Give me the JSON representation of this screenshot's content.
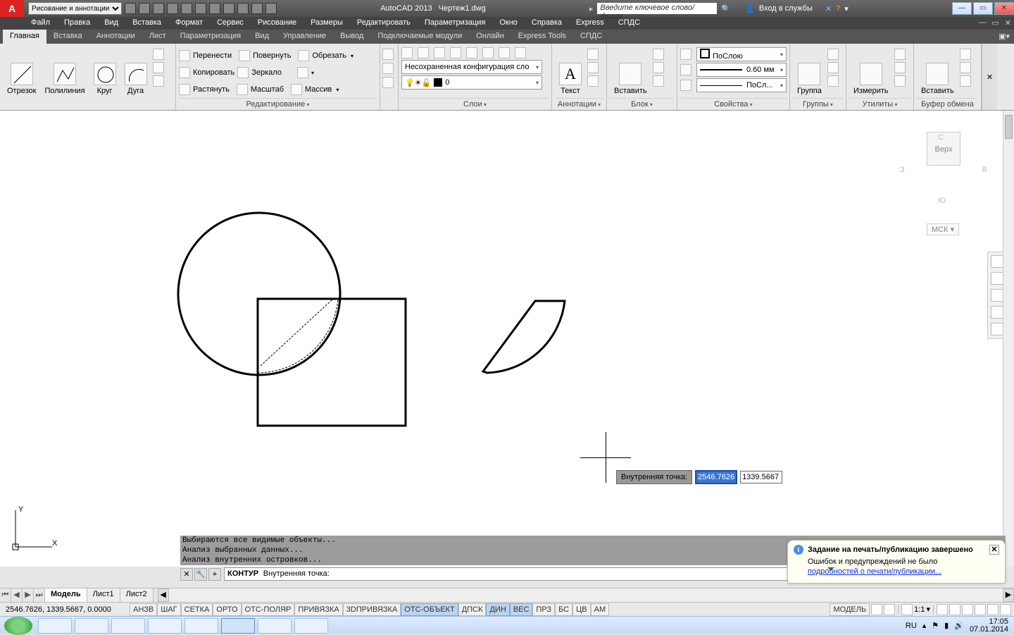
{
  "app": {
    "product": "AutoCAD 2013",
    "file": "Чертеж1.dwg"
  },
  "titlebar": {
    "qat_dropdown": "Рисование и аннотации",
    "search_placeholder": "Введите ключевое слово/фразу",
    "signin": "Вход в службы",
    "win_min": "—",
    "win_max": "▭",
    "win_close": "✕"
  },
  "menus": [
    "Файл",
    "Правка",
    "Вид",
    "Вставка",
    "Формат",
    "Сервис",
    "Рисование",
    "Размеры",
    "Редактировать",
    "Параметризация",
    "Окно",
    "Справка",
    "Express",
    "СПДС"
  ],
  "ribbon_tabs": [
    "Главная",
    "Вставка",
    "Аннотации",
    "Лист",
    "Параметризация",
    "Вид",
    "Управление",
    "Вывод",
    "Подключаемые модули",
    "Онлайн",
    "Express Tools",
    "СПДС"
  ],
  "ribbon_active": "Главная",
  "draw": {
    "line": "Отрезок",
    "pline": "Полилиния",
    "circle": "Круг",
    "arc": "Дуга"
  },
  "modify": {
    "title": "Редактирование",
    "move": "Перенести",
    "rotate": "Повернуть",
    "trim": "Обрезать",
    "copy": "Копировать",
    "mirror": "Зеркало",
    "stretch": "Растянуть",
    "scale": "Масштаб",
    "array": "Массив"
  },
  "layers": {
    "title": "Слои",
    "combo": "Несохраненная конфигурация сло",
    "current": "0"
  },
  "annot": {
    "title": "Аннотации",
    "text": "Текст"
  },
  "block": {
    "title": "Блок",
    "insert": "Вставить"
  },
  "props": {
    "title": "Свойства",
    "color": "ПоСлою",
    "lweight": "0.60 мм",
    "ltype": "ПоСл..."
  },
  "groups": {
    "title": "Группы",
    "btn": "Группа"
  },
  "utils": {
    "title": "Утилиты",
    "measure": "Измерить"
  },
  "clip": {
    "title": "Буфер обмена",
    "paste": "Вставить"
  },
  "draw_tb_title": "Рисование",
  "viewcube": {
    "top": "С",
    "left": "З",
    "right": "В",
    "bottom": "Ю",
    "face": "Верх",
    "wcs": "МСК"
  },
  "dyninput": {
    "label": "Внутренняя точка:",
    "x": "2546.7626",
    "y": "1339.5667"
  },
  "cmd_history": [
    "Выбираются все видимые объекты...",
    "Анализ выбранных данных...",
    "Анализ внутренних островков..."
  ],
  "cmd_current_name": "КОНТУР",
  "cmd_current_prompt": "Внутренняя точка:",
  "balloon": {
    "title": "Задание на печать/публикацию завершено",
    "body": "Ошибок и предупреждений не было",
    "link": "подробностей о печати/публикации..."
  },
  "layout_tabs": [
    "Модель",
    "Лист1",
    "Лист2"
  ],
  "status": {
    "coords": "2546.7626, 1339.5667, 0.0000",
    "toggles": [
      {
        "l": "АНЗВ",
        "on": false
      },
      {
        "l": "ШАГ",
        "on": false
      },
      {
        "l": "СЕТКА",
        "on": false
      },
      {
        "l": "ОРТО",
        "on": false
      },
      {
        "l": "ОТС-ПОЛЯР",
        "on": false
      },
      {
        "l": "ПРИВЯЗКА",
        "on": false
      },
      {
        "l": "3DПРИВЯЗКА",
        "on": false
      },
      {
        "l": "ОТС-ОБЪЕКТ",
        "on": true
      },
      {
        "l": "ДПСК",
        "on": false
      },
      {
        "l": "ДИН",
        "on": true
      },
      {
        "l": "ВЕС",
        "on": true
      },
      {
        "l": "ПРЗ",
        "on": false
      },
      {
        "l": "БС",
        "on": false
      },
      {
        "l": "ЦВ",
        "on": false
      },
      {
        "l": "АМ",
        "on": false
      }
    ],
    "space": "МОДЕЛЬ",
    "scale": "1:1"
  },
  "taskbar": {
    "lang": "RU",
    "time": "17:05",
    "date": "07.01.2014"
  }
}
